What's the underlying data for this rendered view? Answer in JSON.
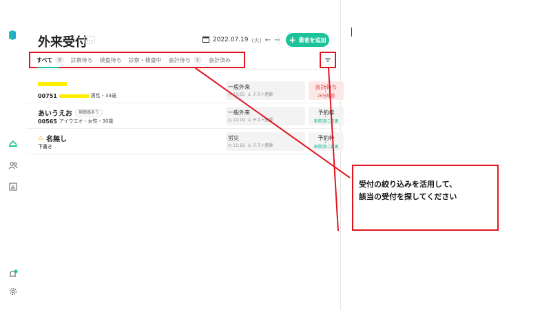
{
  "sidebar": {
    "items": [
      {
        "icon": "app-logo-icon",
        "color": "#1bc29a"
      },
      {
        "icon": "reception-icon",
        "color": "#1bc29a"
      },
      {
        "icon": "patients-icon"
      },
      {
        "icon": "reports-icon"
      },
      {
        "icon": "notifications-icon",
        "badge_color": "#1bc29a"
      },
      {
        "icon": "settings-icon"
      }
    ]
  },
  "header": {
    "title": "外来受付",
    "more": "…",
    "date": "2022.07.19",
    "weekday": "(火)",
    "prev": "←",
    "next": "→",
    "add_button": "患者を追加",
    "add_icon": "+"
  },
  "tabs": [
    {
      "label": "すべて",
      "count": "3"
    },
    {
      "label": "診察待ち",
      "count": ""
    },
    {
      "label": "検査待ち",
      "count": ""
    },
    {
      "label": "診察・検査中",
      "count": ""
    },
    {
      "label": "会計待ち",
      "count": "1"
    },
    {
      "label": "会計済み",
      "count": ""
    }
  ],
  "rows": [
    {
      "name": "",
      "tag": "",
      "patient_id": "00751",
      "detail": "男性・33歳",
      "visit_type": "一般外来",
      "time": "10:55",
      "doctor": "テスト医師",
      "status": "会計待ち",
      "status_sub": "26分経過",
      "status_style": "pink"
    },
    {
      "name": "あいうえお",
      "tag": "補聴器あり",
      "patient_id": "00565",
      "detail": "アイウエオ・女性・30歳",
      "visit_type": "一般外来",
      "time": "11:19",
      "doctor": "テスト医師",
      "status": "予約枠",
      "status_sub": "来院済に変更",
      "status_style": "grey"
    },
    {
      "name": "名無し",
      "tag": "",
      "patient_id": "",
      "detail": "下書き",
      "visit_type": "労災",
      "time": "11:22",
      "doctor": "テスト医師",
      "status": "予約枠",
      "status_sub": "来院済に変更",
      "status_style": "grey"
    }
  ],
  "callout": {
    "line1": "受付の絞り込みを活用して、",
    "line2": "該当の受付を探してください"
  },
  "colors": {
    "accent": "#1bc29a",
    "annotation": "#e0141e",
    "redaction": "#ffee00",
    "status_pink_bg": "#fde8e8",
    "status_pink_text": "#e04848"
  }
}
